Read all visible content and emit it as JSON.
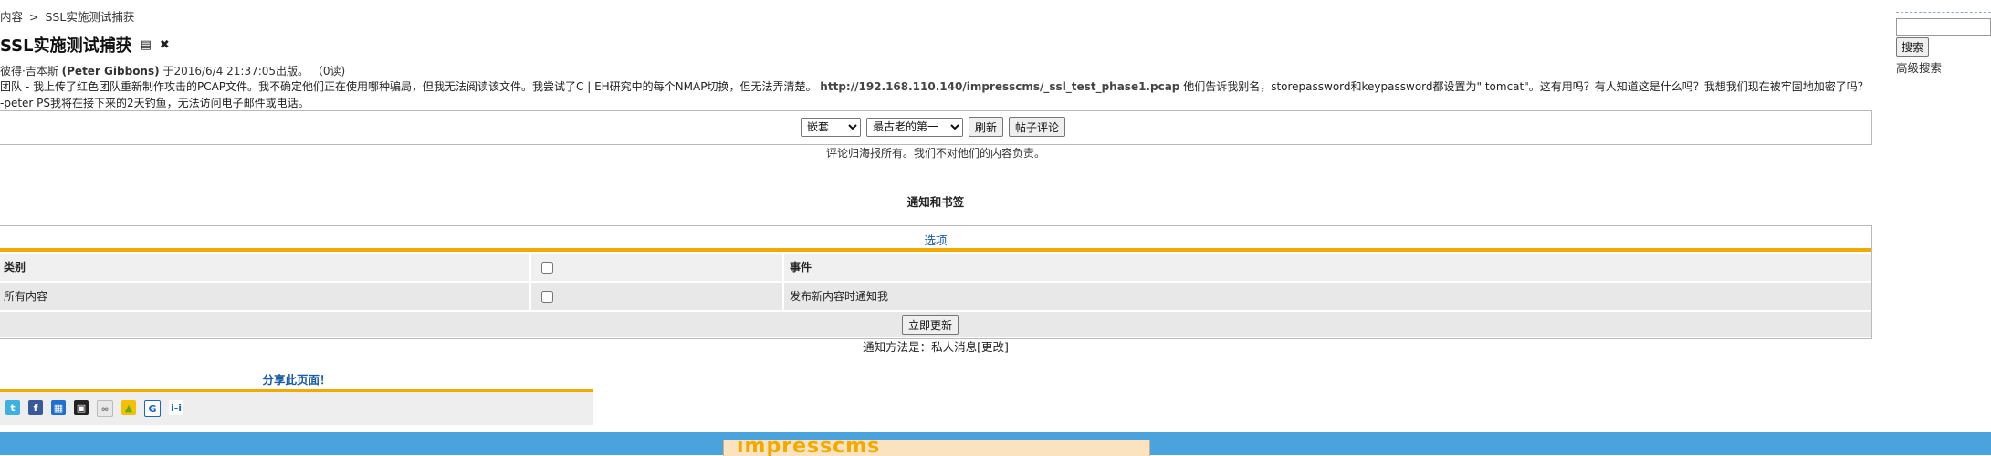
{
  "breadcrumb": {
    "parent": "内容",
    "separator": ">",
    "current": "SSL实施测试捕获"
  },
  "article": {
    "title": "SSL实施测试捕获",
    "meta_author": "彼得·吉本斯",
    "meta_author_en": "(Peter Gibbons)",
    "meta_published": "于2016/6/4 21:37:05出版。",
    "meta_reads": "（0读)",
    "body_before_url": "团队 - 我上传了红色团队重新制作攻击的PCAP文件。我不确定他们正在使用哪种骗局，但我无法阅读该文件。我尝试了C | EH研究中的每个NMAP切换，但无法弄清楚。",
    "body_url": "http://192.168.110.140/impresscms/_ssl_test_phase1.pcap",
    "body_after_url": "他们告诉我别名，storepassword和keypassword都设置为\" tomcat\"。这有用吗？有人知道这是什么吗？我想我们现在被牢固地加密了吗？ -peter PS我将在接下来的2天钓鱼，无法访问电子邮件或电话。"
  },
  "comments_toolbar": {
    "mode_selected": "嵌套",
    "order_selected": "最古老的第一",
    "refresh_label": "刷新",
    "post_comment_label": "帖子评论"
  },
  "disclaimer": "评论归海报所有。我们不对他们的内容负责。",
  "notifications": {
    "heading": "通知和书签",
    "options_link": "选项",
    "col_category": "类别",
    "col_event": "事件",
    "row_category": "所有内容",
    "row_event": "发布新内容时通知我",
    "update_label": "立即更新",
    "method_text": "通知方法是：私人消息[",
    "method_change": "更改",
    "method_close": "]"
  },
  "share": {
    "title": "分享此页面！",
    "icons": [
      "twitter-icon",
      "facebook-icon",
      "windows-live-icon",
      "delicious-icon",
      "digg-icon",
      "yahoo-icon",
      "google-icon",
      "identica-icon"
    ]
  },
  "search": {
    "button_label": "搜索",
    "advanced_label": "高级搜索"
  },
  "colors": {
    "accent": "#f2a900",
    "footer": "#4aa3dc",
    "link": "#1a5aa8"
  }
}
